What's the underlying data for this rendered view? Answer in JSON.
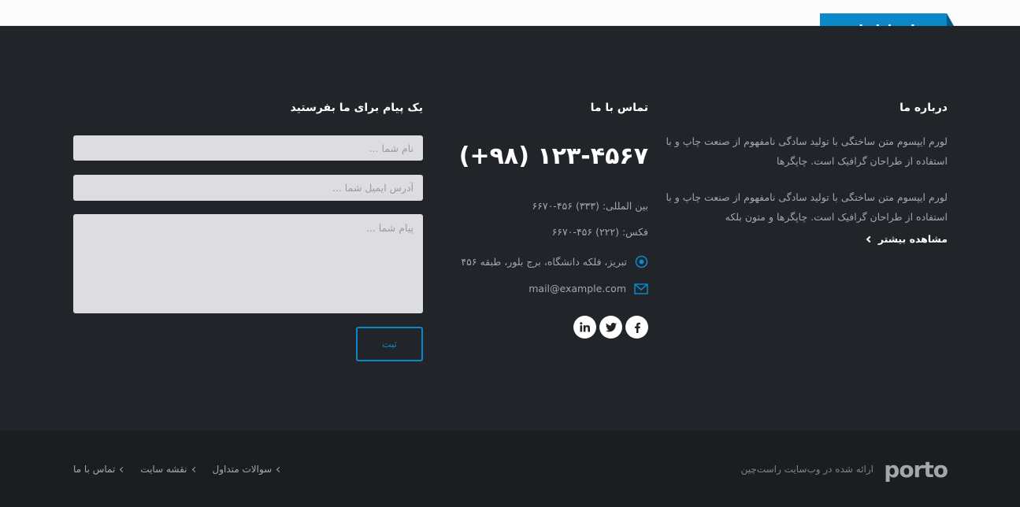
{
  "ribbon": {
    "title": "در ارتباط باشید"
  },
  "about": {
    "title": "درباره ما",
    "paragraph1": "لورم ایپسوم متن ساختگی با تولید سادگی نامفهوم از صنعت چاپ و با استفاده از طراحان گرافیک است. چاپگرها",
    "paragraph2": "لورم ایپسوم متن ساختگی با تولید سادگی نامفهوم از صنعت چاپ و با استفاده از طراحان گرافیک است. چاپگرها و متون بلکه",
    "more_link": "مشاهده بیشتر"
  },
  "contact": {
    "title": "تماس با ما",
    "phone": "(+۹۸) ۱۲۳-۴۵۶۷",
    "international": "بین المللی: (۳۳۳) ۴۵۶-۶۶۷۰",
    "fax": "فکس: (۲۲۲) ۴۵۶-۶۶۷۰",
    "address": "تبریز، فلکه دانشگاه، برج بلور، طبقه ۴۵۶",
    "email": "mail@example.com",
    "socials": [
      "facebook-icon",
      "twitter-icon",
      "linkedin-icon"
    ]
  },
  "form": {
    "title": "یک پیام برای ما بفرستید",
    "name_placeholder": "نام شما ...",
    "email_placeholder": "آدرس ایمیل شما ...",
    "message_placeholder": "پیام شما ...",
    "submit_label": "ثبت"
  },
  "footer": {
    "logo": "porto",
    "powered_by": "ارائه شده در وب‌سایت راست‌چین",
    "links": [
      "تماس با ما",
      "نقشه سایت",
      "سوالات متداول"
    ]
  },
  "colors": {
    "accent": "#0b88c9",
    "background": "#212429",
    "footer": "#1b1d21"
  }
}
